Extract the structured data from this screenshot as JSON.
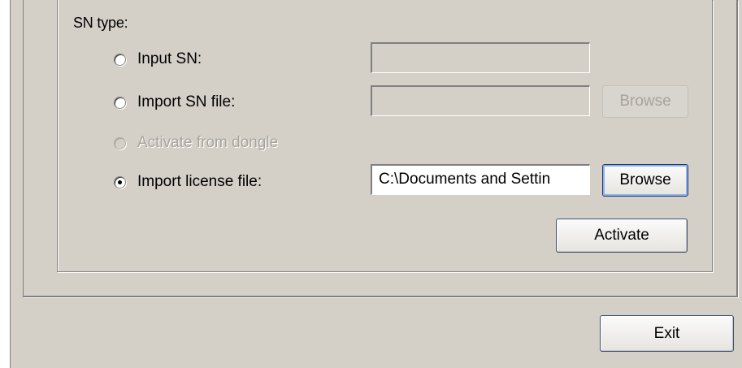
{
  "group": {
    "title": "SN type:"
  },
  "options": [
    {
      "label": "Input SN:",
      "selected": false,
      "enabled": true,
      "field_value": "",
      "field_enabled": false
    },
    {
      "label": "Import SN file:",
      "selected": false,
      "enabled": true,
      "field_value": "",
      "field_enabled": false,
      "browse_label": "Browse",
      "browse_enabled": false
    },
    {
      "label": "Activate from dongle",
      "selected": false,
      "enabled": false
    },
    {
      "label": "Import license file:",
      "selected": true,
      "enabled": true,
      "field_value": "C:\\Documents and Settin",
      "field_enabled": true,
      "browse_label": "Browse",
      "browse_enabled": true
    }
  ],
  "actions": {
    "activate_label": "Activate",
    "exit_label": "Exit"
  }
}
